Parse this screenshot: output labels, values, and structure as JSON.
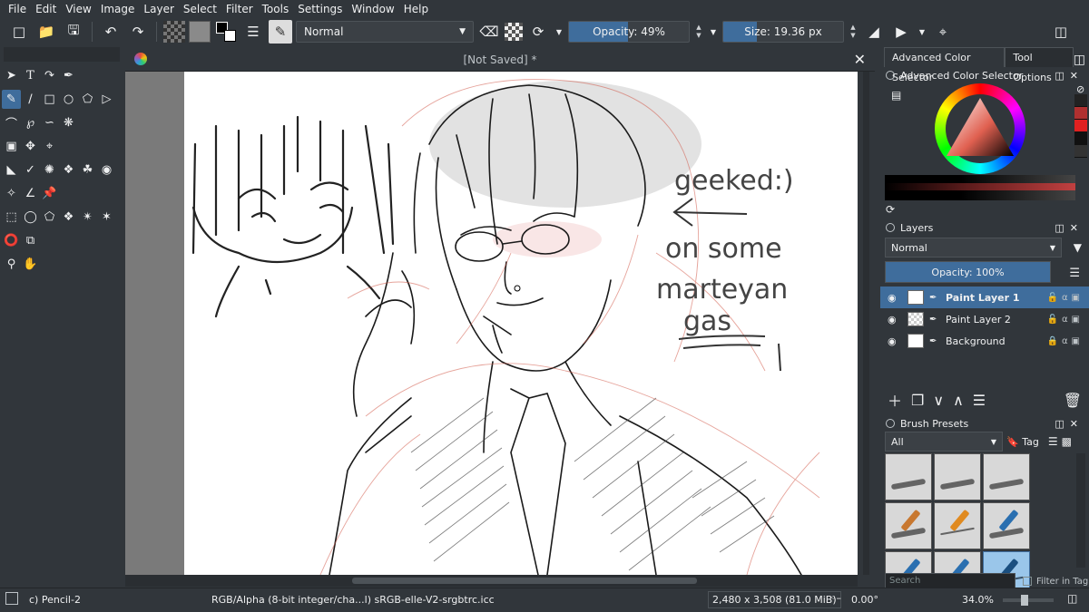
{
  "menu": [
    "File",
    "Edit",
    "View",
    "Image",
    "Layer",
    "Select",
    "Filter",
    "Tools",
    "Settings",
    "Window",
    "Help"
  ],
  "toolbar": {
    "blend_mode": "Normal",
    "opacity_label": "Opacity: 49%",
    "opacity_value": 49,
    "size_label": "Size: 19.36 px",
    "size_fill_fraction": 0.28
  },
  "document": {
    "tab_title": "[Not Saved]  *"
  },
  "canvas_text": {
    "line1": "geeked:)",
    "line2": "on some",
    "line3": "marteyan",
    "line4": "gas"
  },
  "dock": {
    "tab_advanced": "Advanced Color Selector",
    "tab_tool_options": "Tool Options",
    "advanced_panel_title": "Advanced Color Selector",
    "layers_title": "Layers",
    "layers_blend": "Normal",
    "layers_opacity": "Opacity:  100%",
    "layers": [
      {
        "name": "Paint Layer 1",
        "active": true
      },
      {
        "name": "Paint Layer 2",
        "active": false
      },
      {
        "name": "Background",
        "active": false
      }
    ],
    "brush_title": "Brush Presets",
    "brush_filter": "All",
    "brush_tag": "Tag",
    "search_placeholder": "Search",
    "filter_in_tag": "Filter in Tag"
  },
  "status": {
    "brush": "c) Pencil-2",
    "color_space": "RGB/Alpha (8-bit integer/cha...l)  sRGB-elle-V2-srgbtrc.icc",
    "dimensions": "2,480 x 3,508 (81.0 MiB)",
    "rotation": "0.00°",
    "zoom": "34.0%"
  },
  "colors": {
    "accent": "#3f6d9c",
    "background": "#31363b",
    "paper": "#ffffff"
  }
}
